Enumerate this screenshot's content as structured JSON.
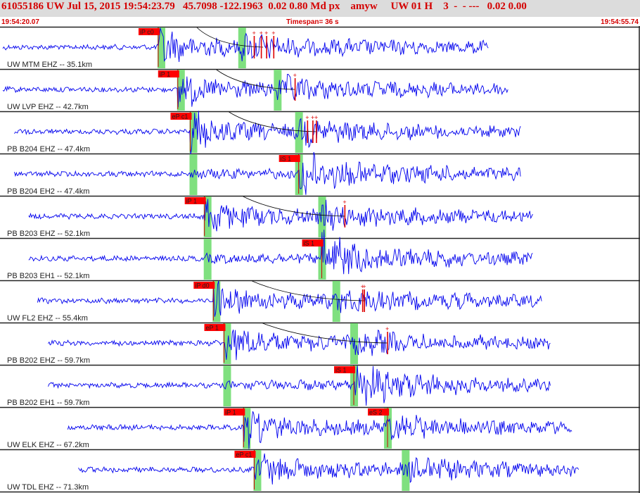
{
  "header": {
    "title": "61055186 UW Jul 15, 2015 19:54:23.79   45.7098 -122.1963  0.02 0.80 Md px    amyw     UW 01 H    3  -  - ---   0.02 0.00",
    "start_time": "19:54:20.07",
    "timespan": "Timespan=  36 s",
    "end_time": "19:54:55.74"
  },
  "colors": {
    "trace": "#0000ee",
    "pick_label_bg": "#ff0000",
    "pick_band": "#7fe07f",
    "header_bg": "#dcdcdc",
    "header_text": "#d40000"
  },
  "chart_data": {
    "type": "line",
    "time_range": [
      "19:54:20.07",
      "19:54:55.74"
    ],
    "timespan_s": 36,
    "traces": [
      {
        "label": "UW MTM EHZ -- 35.1km",
        "p_pick": "iP c0",
        "p_time_s": 8.9,
        "s_time_s": 13.6,
        "s_pick": "",
        "end_s": 27.5,
        "curve_end_s": 14.8,
        "amp_marks_s": [
          14.3,
          14.7,
          15.0,
          15.4
        ]
      },
      {
        "label": "UW LVP EHZ -- 42.7km",
        "p_pick": "iP 1",
        "p_time_s": 10.0,
        "s_time_s": 15.6,
        "s_pick": "",
        "end_s": 28.6,
        "curve_end_s": 16.6,
        "amp_marks_s": [
          16.6
        ]
      },
      {
        "label": "PB B204 EHZ -- 47.4km",
        "p_pick": "eP c1",
        "p_time_s": 10.7,
        "s_time_s": 16.8,
        "s_pick": "",
        "end_s": 29.3,
        "curve_end_s": 17.8,
        "amp_marks_s": [
          17.3,
          17.6,
          17.8
        ]
      },
      {
        "label": "PB B204 EH2 -- 47.4km",
        "p_pick": "",
        "p_time_s": 10.7,
        "s_time_s": 16.8,
        "s_pick": "iS 1",
        "end_s": 29.3,
        "curve_end_s": null,
        "amp_marks_s": []
      },
      {
        "label": "PB B203 EHZ -- 52.1km",
        "p_pick": "iP 1",
        "p_time_s": 11.5,
        "s_time_s": 18.1,
        "s_pick": "",
        "end_s": 30.0,
        "curve_end_s": 19.4,
        "amp_marks_s": [
          19.4
        ]
      },
      {
        "label": "PB B203 EH1 -- 52.1km",
        "p_pick": "",
        "p_time_s": 11.5,
        "s_time_s": 18.1,
        "s_pick": "iS 1",
        "end_s": 30.0,
        "curve_end_s": null,
        "amp_marks_s": []
      },
      {
        "label": "UW FL2 EHZ -- 55.4km",
        "p_pick": "iP d0",
        "p_time_s": 12.0,
        "s_time_s": 18.9,
        "s_pick": "",
        "end_s": 30.5,
        "curve_end_s": 20.5,
        "amp_marks_s": [
          20.4,
          20.5
        ]
      },
      {
        "label": "PB B202 EHZ -- 59.7km",
        "p_pick": "eP 1",
        "p_time_s": 12.6,
        "s_time_s": 19.9,
        "s_pick": "",
        "end_s": 31.0,
        "curve_end_s": 21.8,
        "amp_marks_s": [
          21.8
        ]
      },
      {
        "label": "PB B202 EH1 -- 59.7km",
        "p_pick": "",
        "p_time_s": 12.6,
        "s_time_s": 19.9,
        "s_pick": "iS 1",
        "end_s": 31.0,
        "curve_end_s": null,
        "amp_marks_s": []
      },
      {
        "label": "UW ELK EHZ -- 67.2km",
        "p_pick": "iP 1",
        "p_time_s": 13.7,
        "s_time_s": 21.8,
        "s_pick": "eS 2",
        "end_s": 32.2,
        "curve_end_s": null,
        "amp_marks_s": []
      },
      {
        "label": "UW TDL EHZ -- 71.3km",
        "p_pick": "eP c1",
        "p_time_s": 14.3,
        "s_time_s": 22.8,
        "s_pick": "",
        "end_s": 32.6,
        "curve_end_s": null,
        "amp_marks_s": []
      }
    ]
  }
}
